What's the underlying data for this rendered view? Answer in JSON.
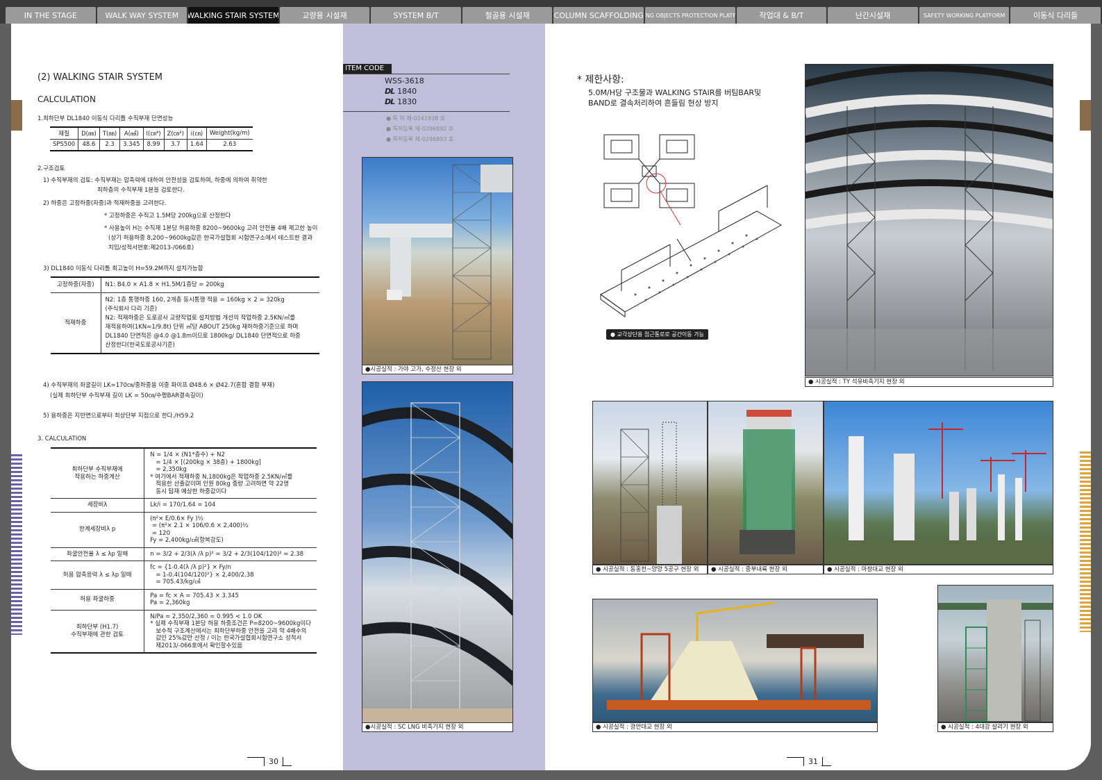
{
  "tabs": [
    {
      "label": "IN THE STAGE",
      "active": false,
      "small": false
    },
    {
      "label": "WALK WAY SYSTEM",
      "active": false,
      "small": false
    },
    {
      "label": "WALKING STAIR SYSTEM",
      "active": true,
      "small": false
    },
    {
      "label": "교량용 시설재",
      "active": false,
      "small": false
    },
    {
      "label": "SYSTEM B/T",
      "active": false,
      "small": false
    },
    {
      "label": "철골용 시설재",
      "active": false,
      "small": false
    },
    {
      "label": "COLUMN SCAFFOLDING",
      "active": false,
      "small": false
    },
    {
      "label": "FALLING OBJECTS PROTECTION PLATFORM",
      "active": false,
      "small": true
    },
    {
      "label": "작업대 & B/T",
      "active": false,
      "small": false
    },
    {
      "label": "난간시설재",
      "active": false,
      "small": false
    },
    {
      "label": "SAFETY WORKING PLATFORM",
      "active": false,
      "small": true
    },
    {
      "label": "이동식 다리들",
      "active": false,
      "small": false
    }
  ],
  "left": {
    "section_title": "(2) WALKING STAIR SYSTEM",
    "calc_title": "CALCULATION",
    "item1": "1.최하단부 DL1840 이동식 다리틀 수직부재 단면성능",
    "prop_table": {
      "headers": [
        "재질",
        "D(㎜)",
        "T(㎜)",
        "A(㎟)",
        "I(㎝⁴)",
        "Z(㎝³)",
        "i(㎝)",
        "Weight(kg/m)"
      ],
      "row": [
        "SPS500",
        "48.6",
        "2.3",
        "3.345",
        "8.99",
        "3.7",
        "1.64",
        "2.63"
      ]
    },
    "item2": "2.구조검토",
    "item2_1a": "1) 수직부재의 검토: 수직부재는 압축력에 대하여 안전성을 검토하며, 하중에 의하여 취약한",
    "item2_1b": "최하층의 수직부재 1본을 검토한다.",
    "item2_2": "2) 하중은 고정하중(자중)과 적재하중을 고려한다.",
    "note1": "* 고정하중은 수직고 1.5M당 200kg으로 산정한다",
    "note2a": "* 사용높이 H는 수직재 1본당 허용하중 8200~9600kg 고려 안전율 4배 제고한 높이",
    "note2b": "(상기 허용하중 8,200~9600kg값은 한국가설협회 시험연구소에서 테스트한 결과",
    "note2c": "치임/성적서번호:제2013-/066호)",
    "item3": "3) DL1840 이동식 다리틀 최고높이 H=59.2M까지 설치가능함",
    "load_rows": [
      {
        "key": "고정하중(자중)",
        "lines": [
          "N1: B4.0 × A1.8 × H1.5M/1층당 = 200kg"
        ]
      },
      {
        "key": "적재하중",
        "lines": [
          "N2: 1층 통행하중 160, 2개층 동시통행 적용 = 160kg × 2 = 320kg",
          "(주식회사 다리 기준)",
          "N2: 적재하중은 도로공사 교량작업로 설치방법 개선의 작업하중 2.5KN/㎡를",
          "재적용하여(1KN=1/9.8t) 단위 ㎡당 ABOUT 250kg 재하하중기준으로 하며",
          "DL1840 단면적은 @4.0 @1.8m이므로 1800kg/ DL1840 단면적으로 하중",
          "산정한다(한국도로공사기준)"
        ]
      }
    ],
    "item4a": "4) 수직부재의 좌굴길이 LK=170㎝/중하중용 이중 파이프 Ø48.6 × Ø42.7(혼합 결합 부재)",
    "item4b": "(실제 최하단부 수직부재 길이 LK = 50㎝/수평BAR결속길이)",
    "item5": "5) 용하중은 지반면으로부터 최상단부 지점으로 한다./H59.2",
    "calc_head": "3. CALCULATION",
    "calc_rows": [
      {
        "key": "최하단부 수직부재에\n작용하는 하중계산",
        "lines": [
          "N = 1/4 × (N1*층수) + N2",
          "   = 1/4 × [(200kg × 38층) + 1800kg]",
          "   = 2,350kg",
          "* 여기에서 적재하중 N,1800kg은 작업하중 2.5KN/㎡를",
          "   적용한 산출값이며 인원 80kg 중량 고려하면 약 22명",
          "   동시 탑재 예상한 하중값이다"
        ]
      },
      {
        "key": "세장비λ",
        "lines": [
          "Lk/i = 170/1.64 = 104"
        ]
      },
      {
        "key": "한계세장비λ p",
        "lines": [
          "(π²× E/0.6× Fy )½",
          " = (π²× 2.1 × 106/0.6 × 2,400)½",
          " = 120",
          "Fy = 2,400kg/㎠(항복강도)"
        ]
      },
      {
        "key": "좌굴안전율 λ ≤ λp 일때",
        "lines": [
          "n = 3/2 + 2/3(λ /λ p)² = 3/2 + 2/3(104/120)² = 2.38"
        ]
      },
      {
        "key": "허용 압축응력 λ ≤ λp 일때",
        "lines": [
          "fc = {1-0.4(λ /λ p)²} × Fy/n",
          "   = 1-0.4(104/120)²} × 2,400/2.38",
          "   = 705.43/kg/㎠"
        ]
      },
      {
        "key": "허용 좌굴하중",
        "lines": [
          "Pa = fc × A = 705.43 × 3.345",
          "Pa = 2,360kg"
        ]
      },
      {
        "key": "최하단부 (H1.7)\n수직부재에 관한 검토",
        "lines": [
          "N/Pa = 2,350/2,360 = 0.995 < 1.0 OK",
          "* 실제 수직부재 1본당 허용 하중조건은 P=8200~9600kg이다",
          "   보수적 구조계산에서는 최하단부하중 안전을 고려 약 4배수의",
          "   값인 25%값만 산정 / 이는 한국가설협회시험연구소 성적서",
          "   제2013/-066호에서 확인할수있음"
        ]
      }
    ],
    "page_num": "30"
  },
  "middle": {
    "item_code_label": "ITEM CODE",
    "codes": [
      {
        "prefix": "",
        "value": "WSS-3618"
      },
      {
        "prefix": "DL",
        "value": "1840"
      },
      {
        "prefix": "DL",
        "value": "1830"
      }
    ],
    "patents": [
      "● 특      허 제-0241938 호",
      "● 특허등록 제-0296892 호",
      "● 특허등록 제-0296893 호"
    ],
    "photo1_caption": "●시공실적 : 가야 고가, 수정산 현장 외",
    "photo2_caption": "●시공실적 : SC LNG 비축기지 현장 외"
  },
  "right": {
    "restrict_title": "* 제한사항:",
    "restrict_line1": "5.0M/H당 구조물과 WALKING STAIR를 버팀BAR및",
    "restrict_line2": "BAND로 결속처리하여 흔들림 현상 방지",
    "diagram_caption": "● 교각상단용 접근통로로 공간이동 가능",
    "captions": {
      "ty": "● 시공실적 : TY 석유비축기지 현장 외",
      "dong": "● 시공실적 : 동홍천~양양 5공구 현장 외",
      "jungbu": "● 시공실적 : 중부내륙 현장 외",
      "machang": "● 시공실적 : 마창대교 현장 외",
      "gwangan": "● 시공실적 : 광안대교 현장 외",
      "salligi": "● 시공실적 : 4대강 살리기 현장 외"
    },
    "page_num": "31"
  }
}
